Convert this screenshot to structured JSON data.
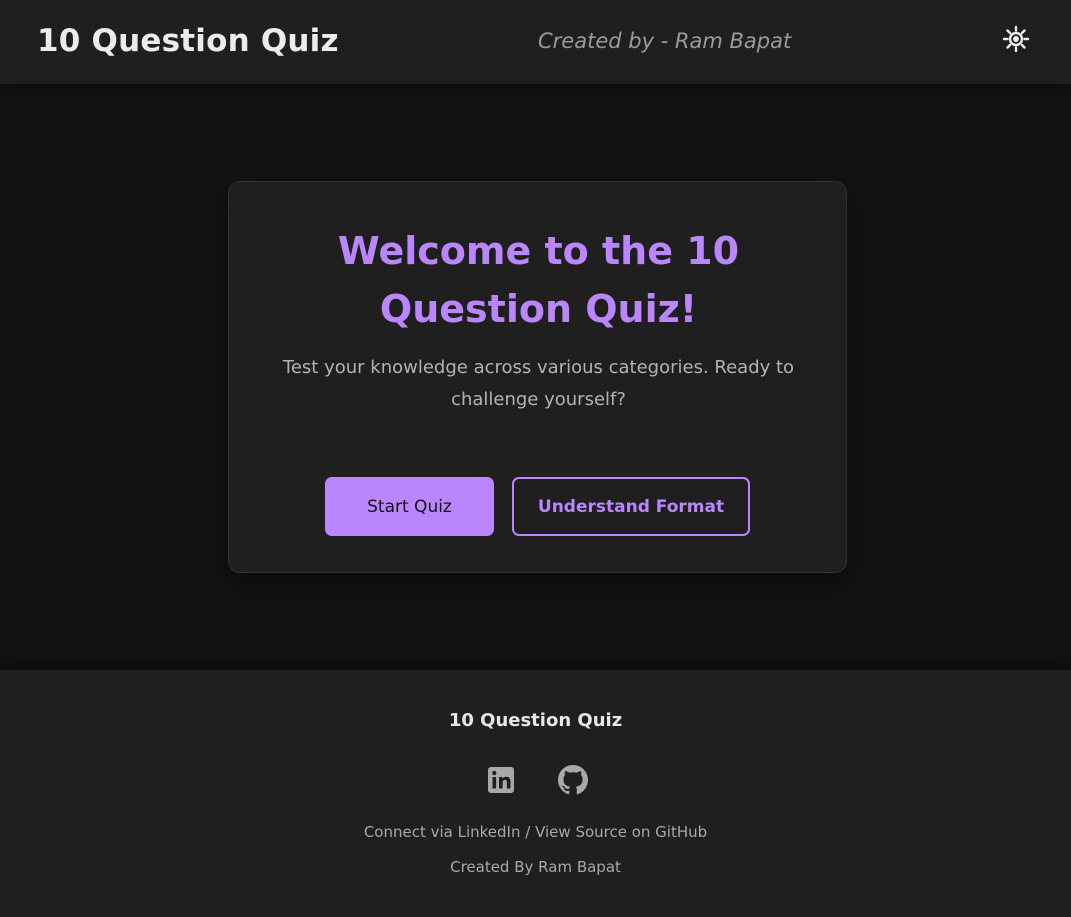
{
  "header": {
    "title": "10 Question Quiz",
    "creator": "Created by - Ram Bapat",
    "theme_icon": "sun-icon"
  },
  "welcome": {
    "title": "Welcome to the 10 Question Quiz!",
    "description": "Test your knowledge across various categories. Ready to challenge yourself?",
    "start_label": "Start Quiz",
    "format_label": "Understand Format"
  },
  "footer": {
    "title": "10 Question Quiz",
    "linkedin_icon": "linkedin-icon",
    "github_icon": "github-icon",
    "connect_label": "Connect via LinkedIn",
    "separator": " / ",
    "source_label": "View Source on GitHub",
    "credit": "Created By Ram Bapat"
  },
  "colors": {
    "accent": "#bb86fc",
    "background": "#131313",
    "surface": "#1f1f1f",
    "text_muted": "#a8a8a8"
  }
}
